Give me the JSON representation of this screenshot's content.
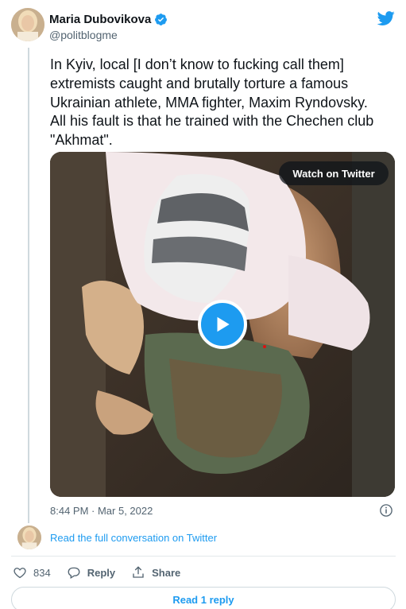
{
  "author": {
    "name": "Maria Dubovikova",
    "handle": "@politblogme",
    "verified": true
  },
  "tweet": {
    "text": "In Kyiv, local [I don’t know to fucking call them]\nextremists caught and brutally torture a famous\nUkrainian athlete, MMA fighter, Maxim Ryndovsky.\nAll his fault is that he trained with the Chechen club\n\"Akhmat\".",
    "timestamp": "8:44 PM · Mar 5, 2022"
  },
  "media": {
    "watch_label": "Watch on Twitter",
    "play_icon": "play-icon"
  },
  "conversation": {
    "link_text": "Read the full conversation on Twitter"
  },
  "actions": {
    "like_count": "834",
    "reply_label": "Reply",
    "share_label": "Share"
  },
  "footer": {
    "read_replies_label": "Read 1 reply"
  },
  "colors": {
    "accent": "#1d9bf0",
    "text": "#0f1419",
    "muted": "#536471",
    "border": "#cfd9de"
  }
}
